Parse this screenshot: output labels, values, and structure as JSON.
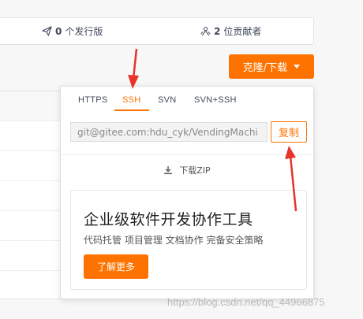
{
  "stats": {
    "releases_count": "0",
    "releases_label": "个发行版",
    "contributors_count": "2",
    "contributors_label": "位贡献者"
  },
  "clone_button": {
    "label": "克隆/下载"
  },
  "clone_dropdown": {
    "tabs": [
      {
        "label": "HTTPS",
        "active": false
      },
      {
        "label": "SSH",
        "active": true
      },
      {
        "label": "SVN",
        "active": false
      },
      {
        "label": "SVN+SSH",
        "active": false
      }
    ],
    "url_value": "git@gitee.com:hdu_cyk/VendingMachi",
    "copy_label": "复制",
    "download_zip_label": "下载ZIP",
    "promo": {
      "title": "企业级软件开发协作工具",
      "subtitle": "代码托管 项目管理 文档协作 完备安全策略",
      "cta_label": "了解更多"
    }
  },
  "watermark": "https://blog.csdn.net/qq_44966875",
  "colors": {
    "accent": "#fe7300",
    "annotation": "#e8332a"
  }
}
